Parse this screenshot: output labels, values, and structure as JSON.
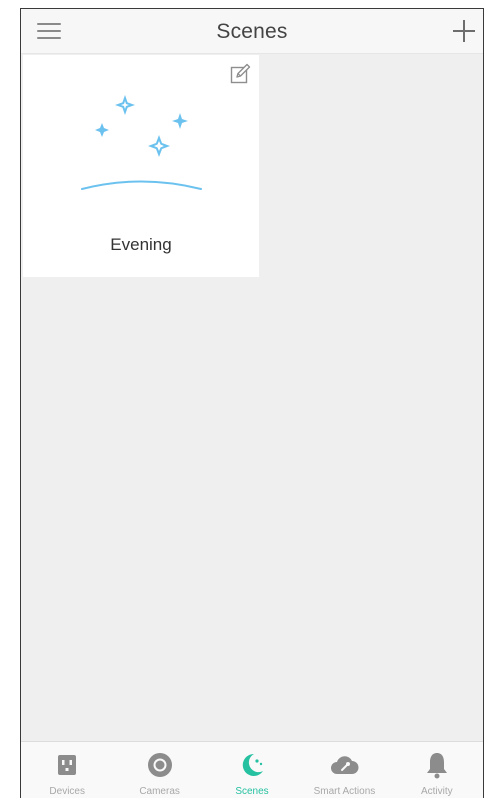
{
  "header": {
    "title": "Scenes",
    "menu_icon": "hamburger-menu-icon",
    "add_icon": "plus-icon"
  },
  "scenes": [
    {
      "name": "Evening",
      "art_icon": "evening-stars-icon",
      "edit_icon": "edit-pencil-icon"
    }
  ],
  "tabs": [
    {
      "label": "Devices",
      "icon": "devices-outlet-icon",
      "active": false
    },
    {
      "label": "Cameras",
      "icon": "camera-lens-icon",
      "active": false
    },
    {
      "label": "Scenes",
      "icon": "scenes-moon-icon",
      "active": true
    },
    {
      "label": "Smart Actions",
      "icon": "smart-actions-cloud-icon",
      "active": false
    },
    {
      "label": "Activity",
      "icon": "activity-bell-icon",
      "active": false
    }
  ],
  "colors": {
    "accent": "#25c1a1",
    "inactive_icon": "#8c8c8c",
    "inactive_label": "#a8a8a8",
    "star_blue": "#6cc2ef",
    "background": "#efefef"
  }
}
